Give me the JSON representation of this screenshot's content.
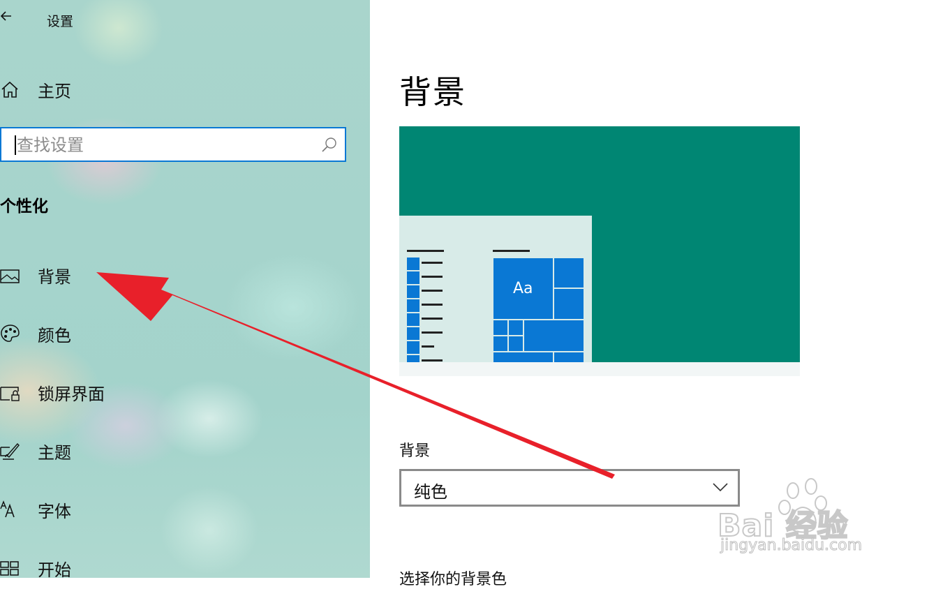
{
  "window": {
    "title": "设置"
  },
  "sidebar": {
    "home_label": "主页",
    "search_placeholder": "查找设置",
    "section_title": "个性化",
    "items": [
      {
        "label": "背景",
        "icon": "picture-icon"
      },
      {
        "label": "颜色",
        "icon": "palette-icon"
      },
      {
        "label": "锁屏界面",
        "icon": "lock-screen-icon"
      },
      {
        "label": "主题",
        "icon": "brush-icon"
      },
      {
        "label": "字体",
        "icon": "font-icon"
      },
      {
        "label": "开始",
        "icon": "start-icon"
      }
    ]
  },
  "main": {
    "page_title": "背景",
    "preview": {
      "tile_label": "Aa",
      "background_color": "#008673",
      "accent_color": "#0a78d4"
    },
    "background_setting": {
      "label": "背景",
      "selected": "纯色"
    },
    "choose_color_label": "选择你的背景色"
  },
  "watermark": {
    "brand": "Bai  经验",
    "url": "jingyan.baidu.com"
  },
  "colors": {
    "accent": "#0a78d4",
    "annotation_arrow": "#e8202a"
  }
}
